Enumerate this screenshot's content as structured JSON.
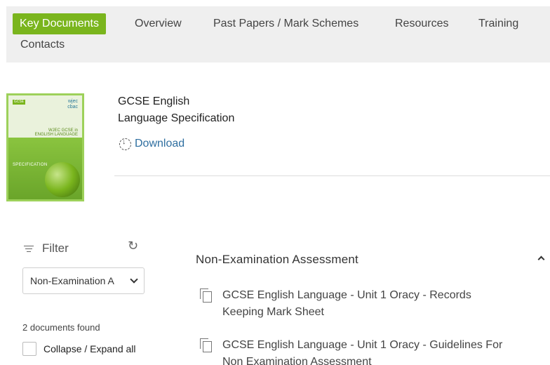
{
  "tabs": [
    {
      "label": "Key Documents",
      "active": true
    },
    {
      "label": "Overview"
    },
    {
      "label": "Past Papers / Mark Schemes"
    },
    {
      "label": "Resources"
    },
    {
      "label": "Training"
    },
    {
      "label": "Contacts"
    }
  ],
  "document": {
    "title_line1": "GCSE English",
    "title_line2": "Language Specification",
    "download_label": "Download",
    "cover": {
      "badge": "GCSE",
      "logo_line1": "wjec",
      "logo_line2": "cbac",
      "title_line1": "WJEC GCSE in",
      "title_line2": "ENGLISH LANGUAGE",
      "spec_label": "SPECIFICATION"
    }
  },
  "filter": {
    "label": "Filter",
    "selected": "Non-Examination A",
    "documents_found": "2 documents found",
    "collapse_label": "Collapse / Expand all"
  },
  "section": {
    "title": "Non-Examination Assessment",
    "items": [
      {
        "line1": "GCSE English Language - Unit 1 Oracy - Records",
        "line2": "Keeping Mark Sheet"
      },
      {
        "line1": "GCSE English Language - Unit 1 Oracy - Guidelines For",
        "line2": "Non Examination Assessment"
      }
    ]
  },
  "colors": {
    "accent": "#7ab51d",
    "link": "#2f6fa0",
    "tabbar_bg": "#efefef"
  },
  "icons": {
    "filter": "filter-lines-icon",
    "refresh": "refresh-icon",
    "download": "download-circle-icon",
    "document": "copy-document-icon",
    "collapse": "chevron-up-icon",
    "dropdown": "chevron-down-icon"
  }
}
